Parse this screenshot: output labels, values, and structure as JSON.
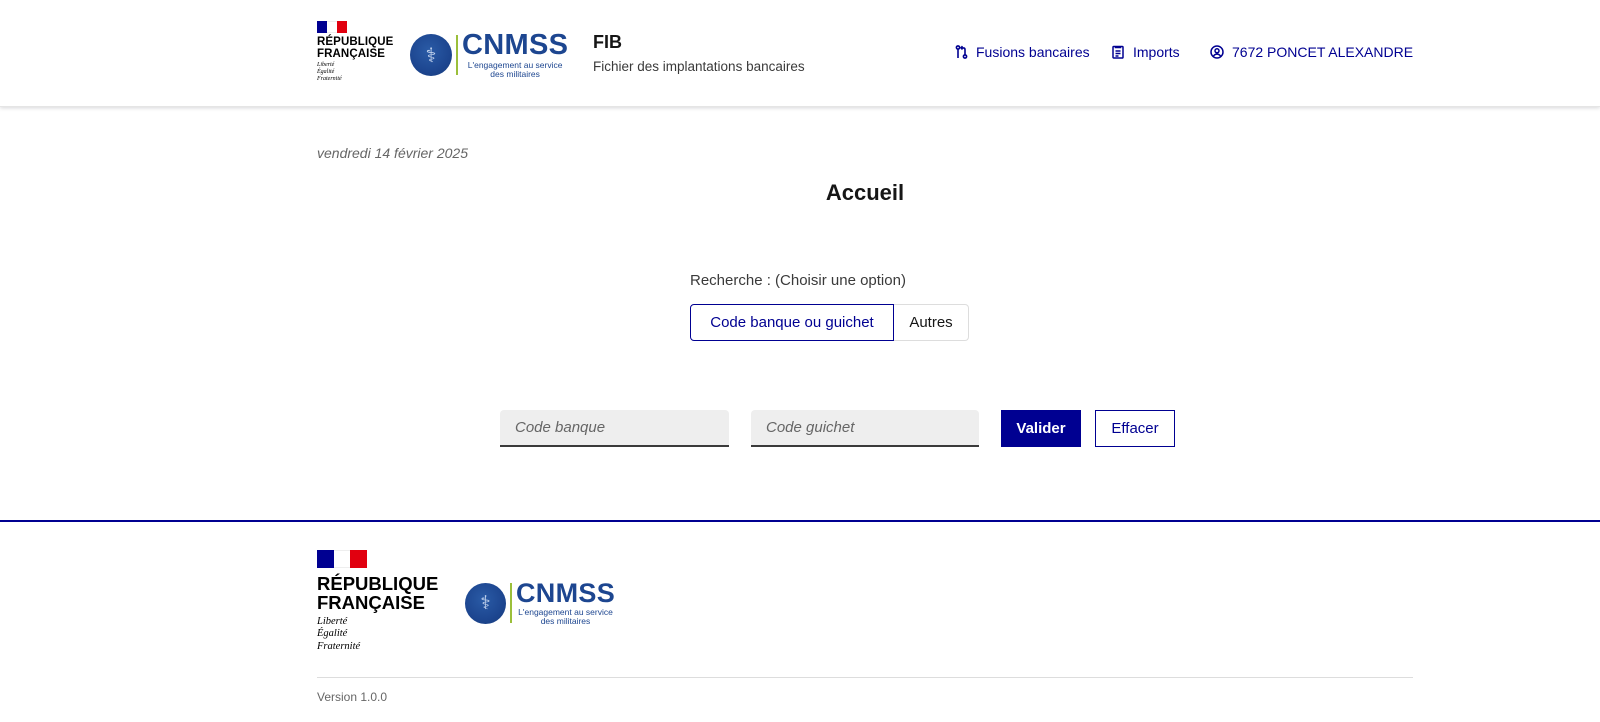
{
  "header": {
    "republique": {
      "line1": "RÉPUBLIQUE",
      "line2": "FRANÇAISE",
      "motto1": "Liberté",
      "motto2": "Égalité",
      "motto3": "Fraternité"
    },
    "cnmss": {
      "name": "CNMSS",
      "tagline1": "L'engagement au service",
      "tagline2": "des militaires"
    },
    "service_title": "FIB",
    "service_tagline": "Fichier des implantations bancaires",
    "nav": [
      {
        "label": "Fusions bancaires",
        "icon": "merge-icon"
      },
      {
        "label": "Imports",
        "icon": "document-icon"
      },
      {
        "label": "7672 PONCET ALEXANDRE",
        "icon": "user-circle-icon"
      }
    ]
  },
  "main": {
    "date": "vendredi 14 février 2025",
    "title": "Accueil",
    "search_legend": "Recherche : (Choisir une option)",
    "options": [
      {
        "label": "Code banque ou guichet",
        "selected": true
      },
      {
        "label": "Autres",
        "selected": false
      }
    ],
    "fields": {
      "code_banque": {
        "placeholder": "Code banque",
        "value": ""
      },
      "code_guichet": {
        "placeholder": "Code guichet",
        "value": ""
      }
    },
    "buttons": {
      "valider": "Valider",
      "effacer": "Effacer"
    }
  },
  "footer": {
    "republique": {
      "line1": "RÉPUBLIQUE",
      "line2": "FRANÇAISE",
      "motto1": "Liberté",
      "motto2": "Égalité",
      "motto3": "Fraternité"
    },
    "cnmss": {
      "name": "CNMSS",
      "tagline1": "L'engagement au service",
      "tagline2": "des militaires"
    },
    "version": "Version 1.0.0"
  },
  "colors": {
    "primary": "#000091",
    "cnmss_blue": "#1d4690",
    "cnmss_green": "#9bbf3a",
    "flag_red": "#e1000f"
  }
}
